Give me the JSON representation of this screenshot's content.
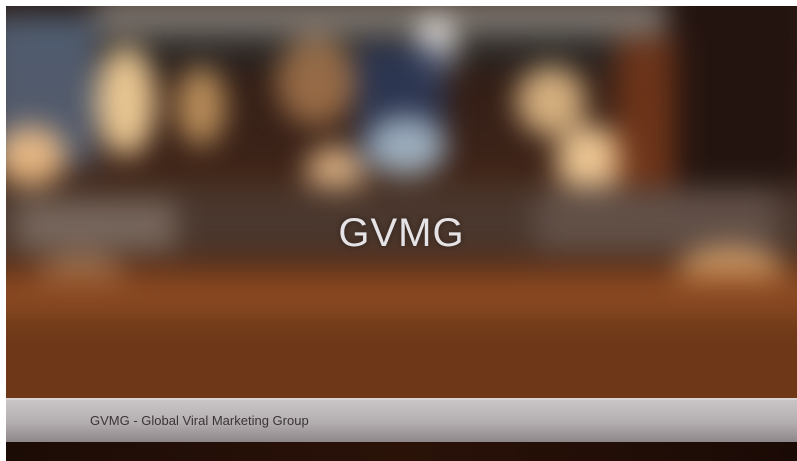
{
  "slide": {
    "title": "GVMG",
    "caption": "GVMG - Global Viral Marketing Group",
    "background_image": "blurred-restaurant-bar-interior",
    "colors": {
      "title": "#e6e3e6",
      "caption_text": "#3a3436",
      "caption_bar": "#b3adaf"
    }
  }
}
